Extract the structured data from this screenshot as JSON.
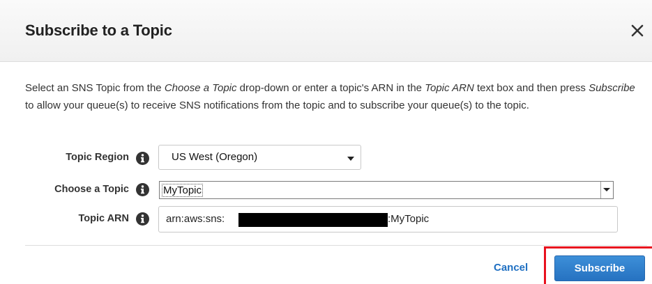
{
  "dialog": {
    "title": "Subscribe to a Topic"
  },
  "description": {
    "part1": "Select an SNS Topic from the ",
    "em1": "Choose a Topic",
    "part2": " drop-down or enter a topic's ARN in the ",
    "em2": "Topic ARN",
    "part3": " text box and then press ",
    "em3": "Subscribe",
    "part4": " to allow your queue(s) to receive SNS notifications from the topic and to subscribe your queue(s) to the topic."
  },
  "form": {
    "region_label": "Topic Region",
    "region_value": "US West (Oregon)",
    "topic_label": "Choose a Topic",
    "topic_value": "MyTopic",
    "arn_label": "Topic ARN",
    "arn_prefix": "arn:aws:sns:",
    "arn_suffix": ":MyTopic"
  },
  "buttons": {
    "cancel": "Cancel",
    "subscribe": "Subscribe"
  },
  "colors": {
    "primary_button": "#2672c1",
    "link": "#1e6fc2",
    "highlight": "#e8111e"
  },
  "icons": [
    "close-icon",
    "info-icon",
    "chevron-down-icon"
  ]
}
